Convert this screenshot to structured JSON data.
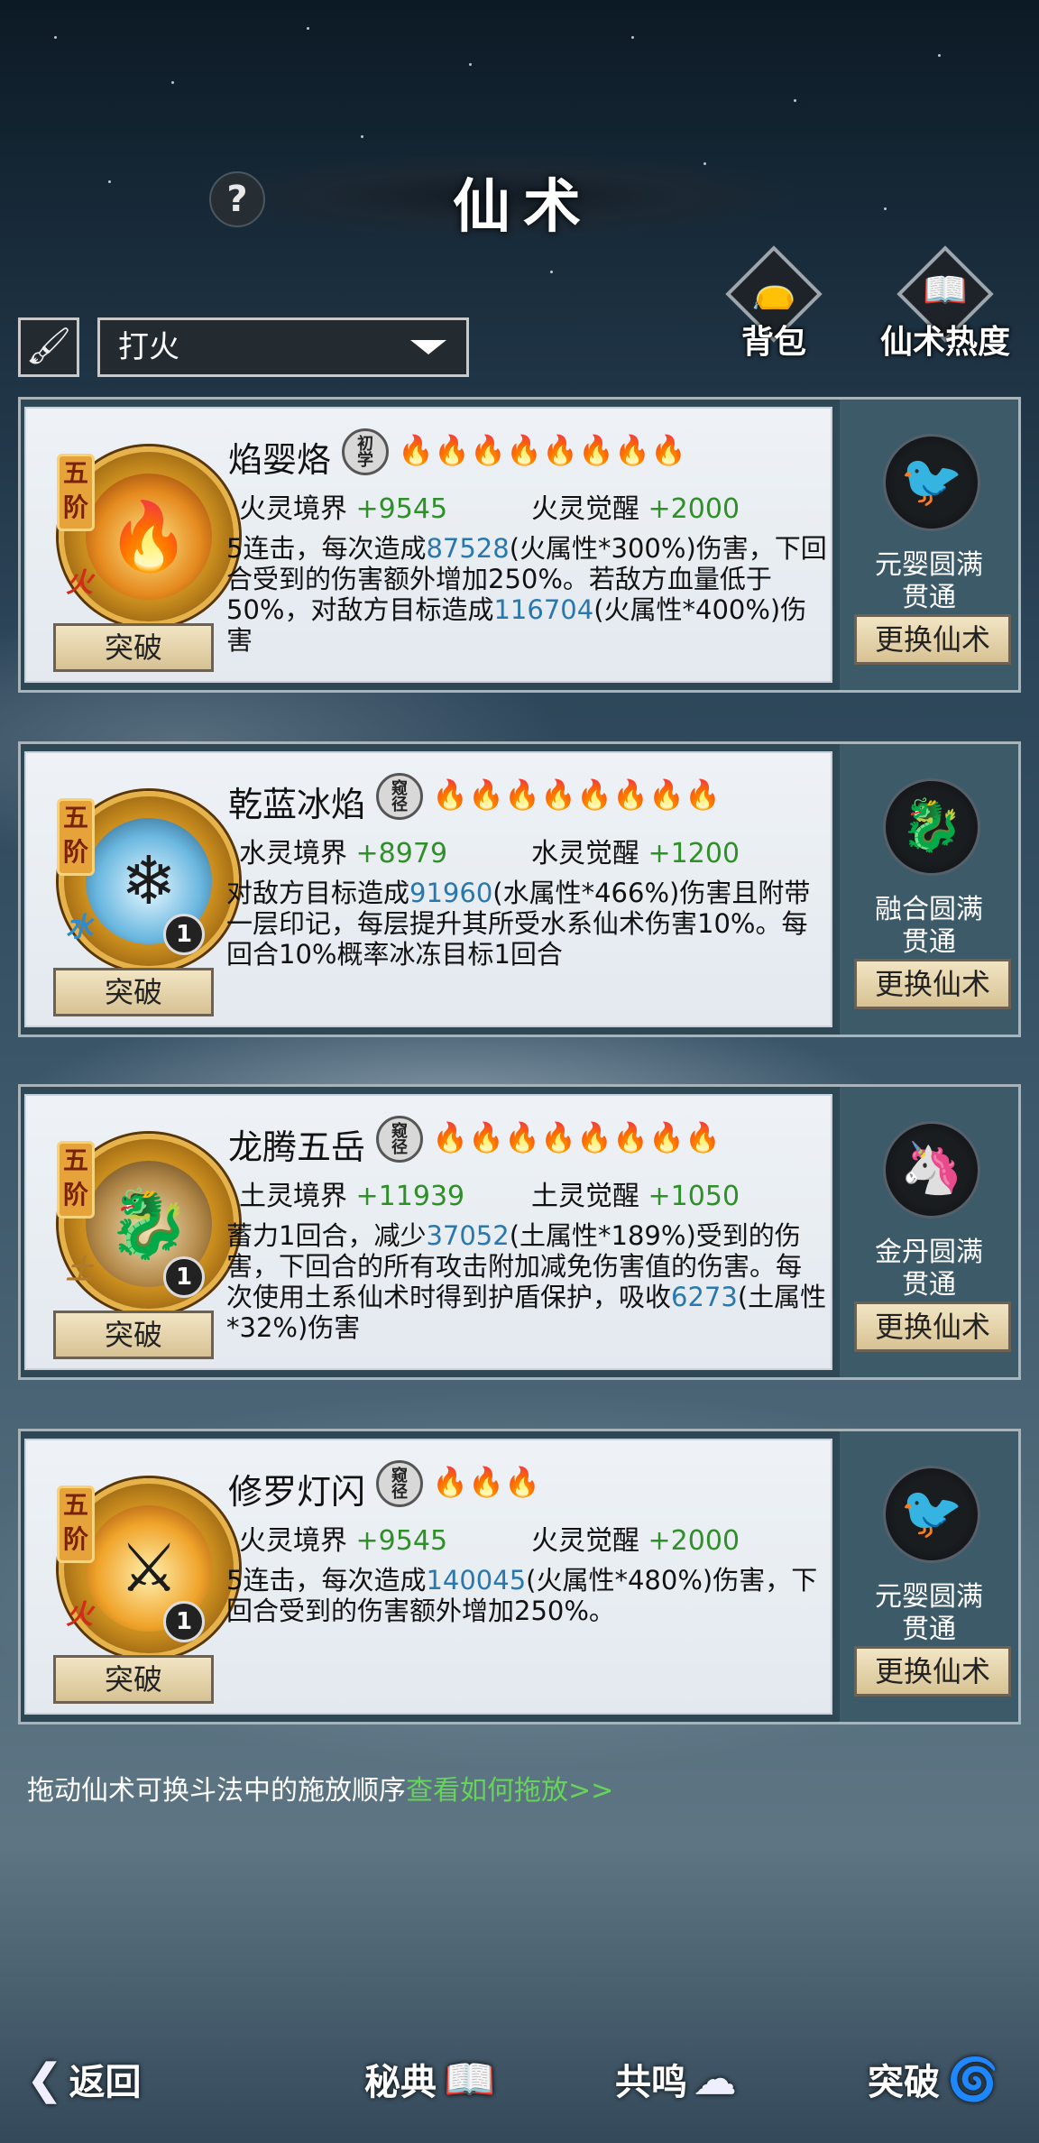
{
  "header": {
    "title": "仙术",
    "help": "?"
  },
  "toolbar": {
    "select_value": "打火",
    "bag_label": "背包",
    "heat_label": "仙术热度"
  },
  "skills": [
    {
      "rank": "五阶",
      "name": "焰婴烙",
      "grade": "初学",
      "flames_on": 0,
      "flames_total": 8,
      "element": "火",
      "level": "",
      "stat1_label": "火灵境界",
      "stat1_value": "+9545",
      "stat2_label": "火灵觉醒",
      "stat2_value": "+2000",
      "desc": [
        [
          "5连击，每次造成",
          ""
        ],
        [
          "87528",
          "n"
        ],
        [
          "(火属性*300%)伤害，下回合受到的伤害额外增加250%。若敌方血量低于50%，对敌方目标造成",
          ""
        ],
        [
          "116704",
          "n"
        ],
        [
          "(火属性*400%)伤害",
          ""
        ]
      ],
      "break_label": "突破",
      "side_t1": "元婴圆满",
      "side_t2": "贯通",
      "swap_label": "更换仙术",
      "side_color": "#d85a4a"
    },
    {
      "rank": "五阶",
      "name": "乾蓝冰焰",
      "grade": "窥径",
      "flames_on": 1,
      "flames_total": 8,
      "element": "水",
      "level": "1",
      "stat1_label": "水灵境界",
      "stat1_value": "+8979",
      "stat2_label": "水灵觉醒",
      "stat2_value": "+1200",
      "desc": [
        [
          "对敌方目标造成",
          ""
        ],
        [
          "91960",
          "n"
        ],
        [
          "(水属性*466%)伤害且附带一层印记，每层提升其所受水系仙术伤害10%。每回合10%概率冰冻目标1回合",
          ""
        ]
      ],
      "break_label": "突破",
      "side_t1": "融合圆满",
      "side_t2": "贯通",
      "swap_label": "更换仙术",
      "side_color": "#4ab6d8"
    },
    {
      "rank": "五阶",
      "name": "龙腾五岳",
      "grade": "窥径",
      "flames_on": 1,
      "flames_total": 8,
      "element": "土",
      "level": "1",
      "stat1_label": "土灵境界",
      "stat1_value": "+11939",
      "stat2_label": "土灵觉醒",
      "stat2_value": "+1050",
      "desc": [
        [
          "蓄力1回合，减少",
          ""
        ],
        [
          "37052",
          "n"
        ],
        [
          "(土属性*189%)受到的伤害，下回合的所有攻击附加减免伤害值的伤害。每次使用土系仙术时得到护盾保护，吸收",
          ""
        ],
        [
          "6273",
          "n"
        ],
        [
          "(土属性*32%)伤害",
          ""
        ]
      ],
      "break_label": "突破",
      "side_t1": "金丹圆满",
      "side_t2": "贯通",
      "swap_label": "更换仙术",
      "side_color": "#d8b06a"
    },
    {
      "rank": "五阶",
      "name": "修罗灯闪",
      "grade": "窥径",
      "flames_on": 1,
      "flames_total": 3,
      "element": "火",
      "level": "1",
      "stat1_label": "火灵境界",
      "stat1_value": "+9545",
      "stat2_label": "火灵觉醒",
      "stat2_value": "+2000",
      "desc": [
        [
          "5连击，每次造成",
          ""
        ],
        [
          "140045",
          "n"
        ],
        [
          "(火属性*480%)伤害，下回合受到的伤害额外增加250%。",
          ""
        ]
      ],
      "break_label": "突破",
      "side_t1": "元婴圆满",
      "side_t2": "贯通",
      "swap_label": "更换仙术",
      "side_color": "#d85a4a"
    }
  ],
  "hint": {
    "text": "拖动仙术可换斗法中的施放顺序",
    "link": "查看如何拖放>>"
  },
  "nav": {
    "back": "返回",
    "secret": "秘典",
    "resonance": "共鸣",
    "breakthrough": "突破"
  },
  "colors": {
    "accent_green": "#2f8f28",
    "number_blue": "#2a77ad",
    "link_green": "#67d35a"
  }
}
